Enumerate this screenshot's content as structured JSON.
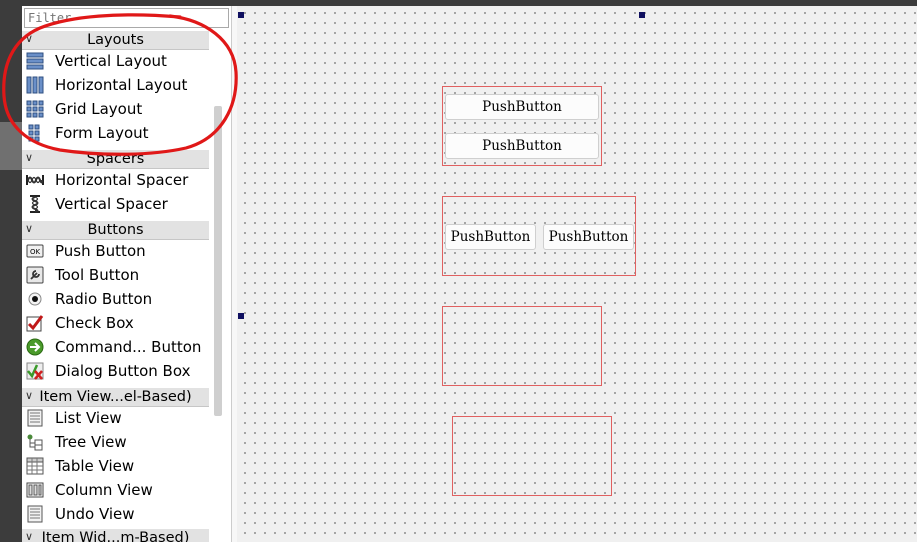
{
  "filter": {
    "placeholder": "Filter"
  },
  "categories": {
    "layouts": "Layouts",
    "spacers": "Spacers",
    "buttons": "Buttons",
    "item_views": "Item View...el-Based)",
    "item_widgets": "Item Wid...m-Based)"
  },
  "layouts": [
    {
      "label": "Vertical Layout",
      "icon": "vertical-layout-icon"
    },
    {
      "label": "Horizontal Layout",
      "icon": "horizontal-layout-icon"
    },
    {
      "label": "Grid Layout",
      "icon": "grid-layout-icon"
    },
    {
      "label": "Form Layout",
      "icon": "form-layout-icon"
    }
  ],
  "spacers": [
    {
      "label": "Horizontal Spacer",
      "icon": "horizontal-spacer-icon"
    },
    {
      "label": "Vertical Spacer",
      "icon": "vertical-spacer-icon"
    }
  ],
  "buttons": [
    {
      "label": "Push Button",
      "icon": "push-button-icon",
      "icon_text": "OK"
    },
    {
      "label": "Tool Button",
      "icon": "tool-button-icon"
    },
    {
      "label": "Radio Button",
      "icon": "radio-button-icon"
    },
    {
      "label": "Check Box",
      "icon": "check-box-icon"
    },
    {
      "label": "Command... Button",
      "icon": "command-link-icon"
    },
    {
      "label": "Dialog Button Box",
      "icon": "dialog-button-box-icon"
    }
  ],
  "item_views": [
    {
      "label": "List View",
      "icon": "list-view-icon"
    },
    {
      "label": "Tree View",
      "icon": "tree-view-icon"
    },
    {
      "label": "Table View",
      "icon": "table-view-icon"
    },
    {
      "label": "Column View",
      "icon": "column-view-icon"
    },
    {
      "label": "Undo View",
      "icon": "undo-view-icon"
    }
  ],
  "canvas": {
    "vertical_layout_buttons": [
      "PushButton",
      "PushButton"
    ],
    "horizontal_layout_buttons": [
      "PushButton",
      "PushButton"
    ]
  },
  "colors": {
    "annotation": "#e01818",
    "layout_border": "#e06060",
    "handle": "#101060"
  }
}
